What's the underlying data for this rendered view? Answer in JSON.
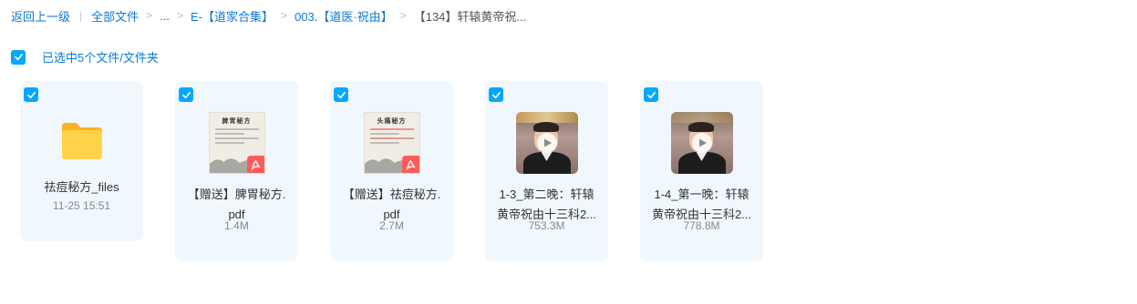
{
  "breadcrumb": {
    "back": "返回上一级",
    "all_files": "全部文件",
    "ellipsis": "...",
    "level1": "E-【道家合集】",
    "level2": "003.【道医·祝由】",
    "current": "【134】轩辕黄帝祝..."
  },
  "selection": {
    "label": "已选中5个文件/文件夹"
  },
  "colors": {
    "accent": "#06a7ff",
    "link": "#0b7ad6",
    "card_bg": "#f1f8fd",
    "pdf_badge": "#ff5b5b",
    "folder": "#ffc83d"
  },
  "files": [
    {
      "type": "folder",
      "icon": "folder-icon",
      "name": "祛痘秘方_files",
      "meta": "11-25 15:51",
      "selected": true
    },
    {
      "type": "pdf",
      "icon": "pdf-icon",
      "thumb_title": "脾胃秘方",
      "name_line1": "【赠送】脾胃秘方.",
      "name_line2": "pdf",
      "meta": "1.4M",
      "selected": true
    },
    {
      "type": "pdf",
      "icon": "pdf-icon",
      "thumb_title": "头痛秘方",
      "name_line1": "【赠送】祛痘秘方.",
      "name_line2": "pdf",
      "meta": "2.7M",
      "selected": true
    },
    {
      "type": "video",
      "icon": "play-icon",
      "name_line1": "1-3_第二晚：轩辕",
      "name_line2": "黄帝祝由十三科2...",
      "meta": "753.3M",
      "selected": true
    },
    {
      "type": "video",
      "icon": "play-icon",
      "name_line1": "1-4_第一晚：轩辕",
      "name_line2": "黄帝祝由十三科2...",
      "meta": "778.8M",
      "selected": true
    }
  ]
}
